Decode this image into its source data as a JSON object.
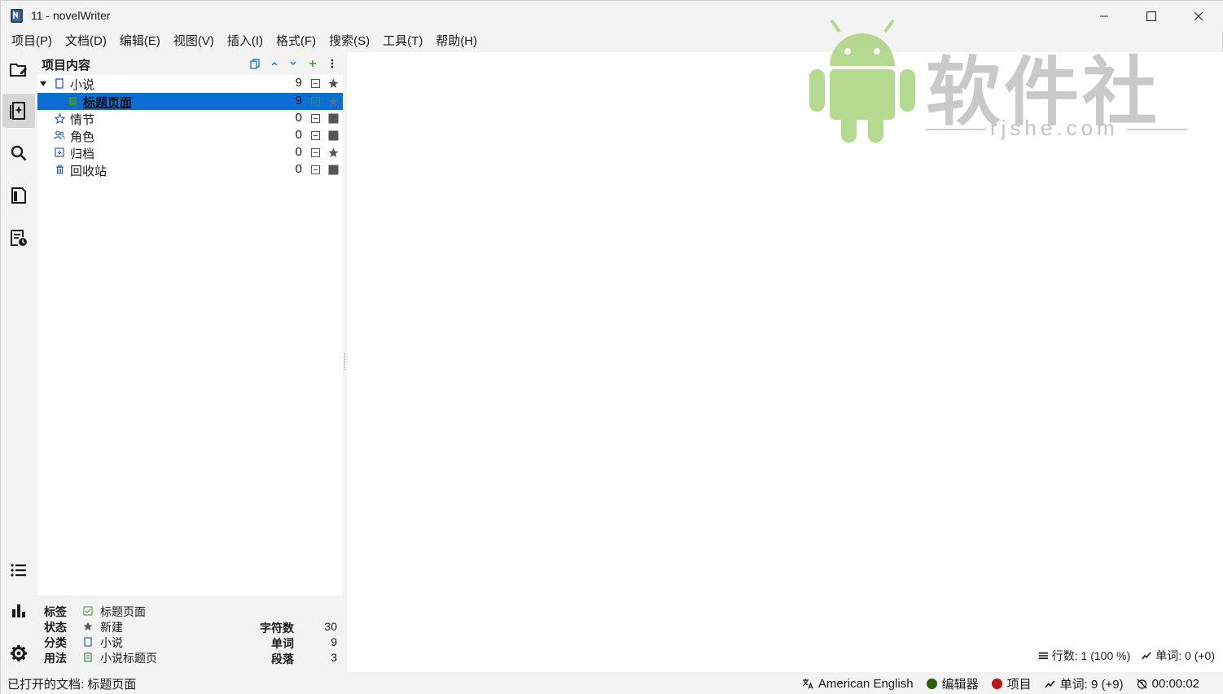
{
  "window": {
    "title": "11 - novelWriter",
    "minimize_icon": "minimize-icon",
    "maximize_icon": "maximize-icon",
    "close_icon": "close-icon"
  },
  "menubar": {
    "items": [
      "项目(P)",
      "文档(D)",
      "编辑(E)",
      "视图(V)",
      "插入(I)",
      "格式(F)",
      "搜索(S)",
      "工具(T)",
      "帮助(H)"
    ]
  },
  "rail": {
    "items": [
      "project-tree-icon",
      "novel-tree-icon",
      "search-icon",
      "outline-icon",
      "manuscript-icon"
    ],
    "bottom": [
      "list-icon",
      "stats-icon",
      "settings-icon"
    ]
  },
  "project_panel": {
    "title": "项目内容",
    "tree": [
      {
        "label": "小说",
        "count": "9",
        "icon": "novel-icon",
        "status": "star"
      },
      {
        "label": "标题页面",
        "count": "9",
        "icon": "document-icon",
        "status": "star",
        "selected": true
      },
      {
        "label": "情节",
        "count": "0",
        "icon": "plot-icon",
        "status": "square"
      },
      {
        "label": "角色",
        "count": "0",
        "icon": "character-icon",
        "status": "square"
      },
      {
        "label": "归档",
        "count": "0",
        "icon": "archive-icon",
        "status": "star"
      },
      {
        "label": "回收站",
        "count": "0",
        "icon": "trash-icon",
        "status": "square"
      }
    ]
  },
  "details": {
    "labels": {
      "tag": "标签",
      "status": "状态",
      "class": "分类",
      "usage": "用法"
    },
    "values": {
      "tag": "标题页面",
      "status": "新建",
      "class": "小说",
      "usage": "小说标题页"
    },
    "stat_labels": {
      "chars": "字符数",
      "words": "单词",
      "paras": "段落"
    },
    "stat_values": {
      "chars": "30",
      "words": "9",
      "paras": "3"
    }
  },
  "editor": {
    "footer": {
      "lines": "行数: 1 (100 %)",
      "words": "单词: 0 (+0)"
    }
  },
  "watermark": {
    "text": "软件社",
    "sub": "rjshe.com"
  },
  "statusbar": {
    "left": "已打开的文档: 标题页面",
    "language": "American English",
    "editor": "编辑器",
    "project": "项目",
    "words": "单词: 9 (+9)",
    "time": "00:00:02",
    "colors": {
      "editor_dot": "#2f5e0b",
      "project_dot": "#b71414"
    }
  },
  "colors": {
    "accent": "#0a6ed3",
    "background": "#f3f3f3"
  }
}
